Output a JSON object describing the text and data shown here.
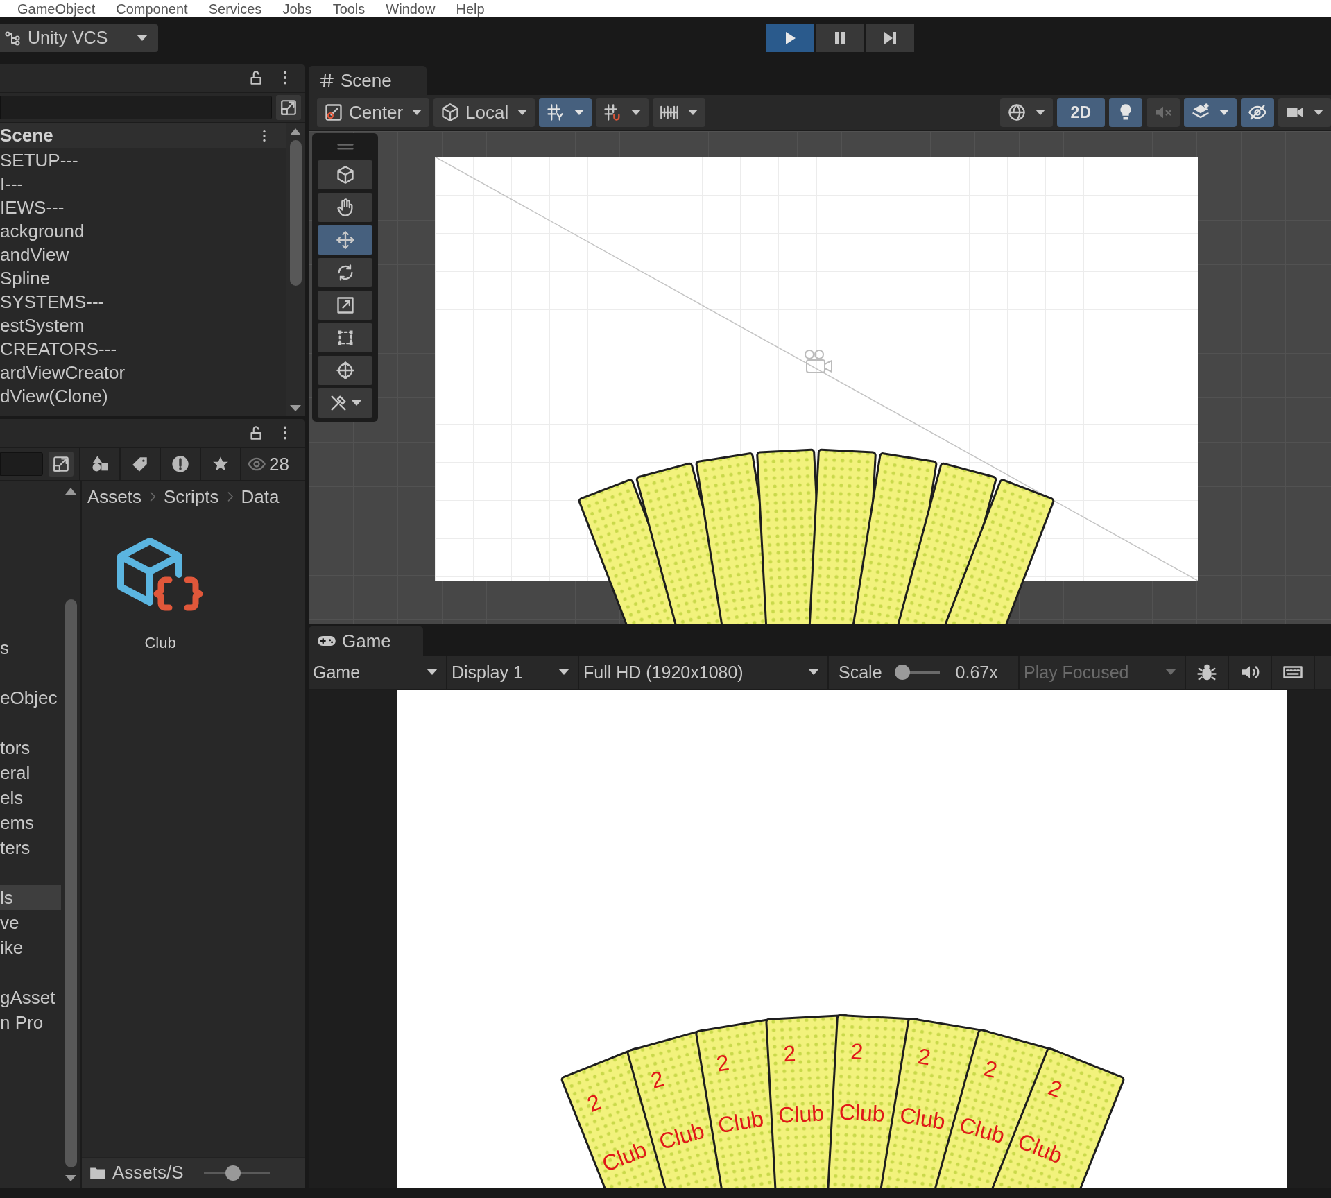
{
  "menu_bar": {
    "items": [
      "GameObject",
      "Component",
      "Services",
      "Jobs",
      "Tools",
      "Window",
      "Help"
    ]
  },
  "toolbar": {
    "vcs_button": "Unity VCS",
    "play_controls": [
      {
        "kind": "play",
        "selected": true
      },
      {
        "kind": "pause",
        "selected": false
      },
      {
        "kind": "step",
        "selected": false
      }
    ]
  },
  "hierarchy": {
    "scene": "Scene",
    "items": [
      "SETUP---",
      "I---",
      "IEWS---",
      "ackground",
      "andView",
      "Spline",
      "SYSTEMS---",
      "estSystem",
      "CREATORS---",
      "ardViewCreator",
      "dView(Clone)"
    ]
  },
  "project": {
    "count": "28",
    "breadcrumb": [
      "Assets",
      "Scripts",
      "Data"
    ],
    "tree_groups": [
      [
        {
          "label": "s",
          "selected": false
        }
      ],
      [
        {
          "label": "eObjec",
          "selected": false
        }
      ],
      [
        {
          "label": "tors",
          "selected": false
        },
        {
          "label": "eral",
          "selected": false
        },
        {
          "label": "els",
          "selected": false
        },
        {
          "label": "ems",
          "selected": false
        },
        {
          "label": "ters",
          "selected": false
        }
      ],
      [
        {
          "label": "ls",
          "selected": true
        },
        {
          "label": "ve",
          "selected": false
        },
        {
          "label": "ike",
          "selected": false
        }
      ],
      [
        {
          "label": "gAsset",
          "selected": false
        },
        {
          "label": "n Pro",
          "selected": false
        }
      ]
    ],
    "assets": [
      {
        "name": "Club"
      }
    ],
    "footer": {
      "path": "Assets/S",
      "level": 0.45
    }
  },
  "scene": {
    "tab": "Scene",
    "toolbar": [
      {
        "kind": "pivot",
        "label": "Center"
      },
      {
        "kind": "orientation",
        "label": "Local"
      },
      {
        "kind": "grid_snap",
        "on": true
      },
      {
        "kind": "increment_snap",
        "on": false
      },
      {
        "kind": "grid_increment",
        "on": false
      },
      {
        "kind": "shading",
        "on": false
      },
      {
        "kind": "mode_2d",
        "label": "2D",
        "on": true
      },
      {
        "kind": "lighting",
        "on": true
      },
      {
        "kind": "audio",
        "on": false
      },
      {
        "kind": "effects",
        "on": true
      },
      {
        "kind": "visibility",
        "on": true
      },
      {
        "kind": "camera",
        "on": false
      }
    ],
    "tools": [
      {
        "kind": "cube",
        "selected": false
      },
      {
        "kind": "hand",
        "selected": false
      },
      {
        "kind": "move",
        "selected": true
      },
      {
        "kind": "rotate",
        "selected": false
      },
      {
        "kind": "scale",
        "selected": false
      },
      {
        "kind": "rect",
        "selected": false
      },
      {
        "kind": "transform",
        "selected": false
      },
      {
        "kind": "custom",
        "selected": false
      }
    ]
  },
  "game": {
    "tab": "Game",
    "view_dropdown": "Game",
    "display_dropdown": "Display 1",
    "resolution_dropdown": "Full HD (1920x1080)",
    "scale": {
      "label": "Scale",
      "level": 0.1,
      "reading": "0.67x"
    },
    "play_mode": {
      "value": "Play Focused",
      "disabled": true
    },
    "toggles": [
      {
        "kind": "bug",
        "on": false
      },
      {
        "kind": "audio",
        "on": false
      },
      {
        "kind": "keyboard",
        "on": false
      }
    ],
    "cards": [
      {
        "rank": "2",
        "suit": "Club"
      },
      {
        "rank": "2",
        "suit": "Club"
      },
      {
        "rank": "2",
        "suit": "Club"
      },
      {
        "rank": "2",
        "suit": "Club"
      },
      {
        "rank": "2",
        "suit": "Club"
      },
      {
        "rank": "2",
        "suit": "Club"
      },
      {
        "rank": "2",
        "suit": "Club"
      },
      {
        "rank": "2",
        "suit": "Club"
      }
    ]
  }
}
